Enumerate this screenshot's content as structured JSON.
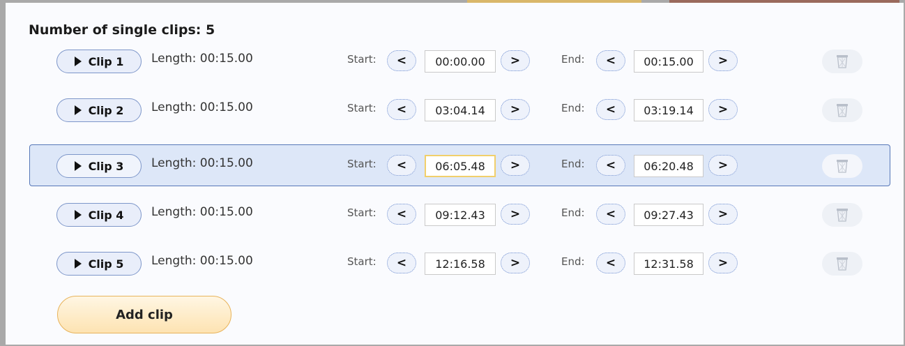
{
  "title": "Number of single clips: 5",
  "labels": {
    "start": "Start:",
    "end": "End:",
    "prev": "<",
    "next": ">"
  },
  "add_clip_label": "Add clip",
  "colors": {
    "selected_row": "#dde7f8",
    "selected_border": "#5677b8",
    "add_button": "#fde3b2",
    "focus": "#f1cf6b"
  },
  "clips": [
    {
      "label": "Clip 1",
      "length": "Length: 00:15.00",
      "start": "00:00.00",
      "end": "00:15.00"
    },
    {
      "label": "Clip 2",
      "length": "Length: 00:15.00",
      "start": "03:04.14",
      "end": "03:19.14"
    },
    {
      "label": "Clip 3",
      "length": "Length: 00:15.00",
      "start": "06:05.48",
      "end": "06:20.48"
    },
    {
      "label": "Clip 4",
      "length": "Length: 00:15.00",
      "start": "09:12.43",
      "end": "09:27.43"
    },
    {
      "label": "Clip 5",
      "length": "Length: 00:15.00",
      "start": "12:16.58",
      "end": "12:31.58"
    }
  ],
  "icons": {
    "play": "play-icon",
    "delete": "trash-icon"
  }
}
